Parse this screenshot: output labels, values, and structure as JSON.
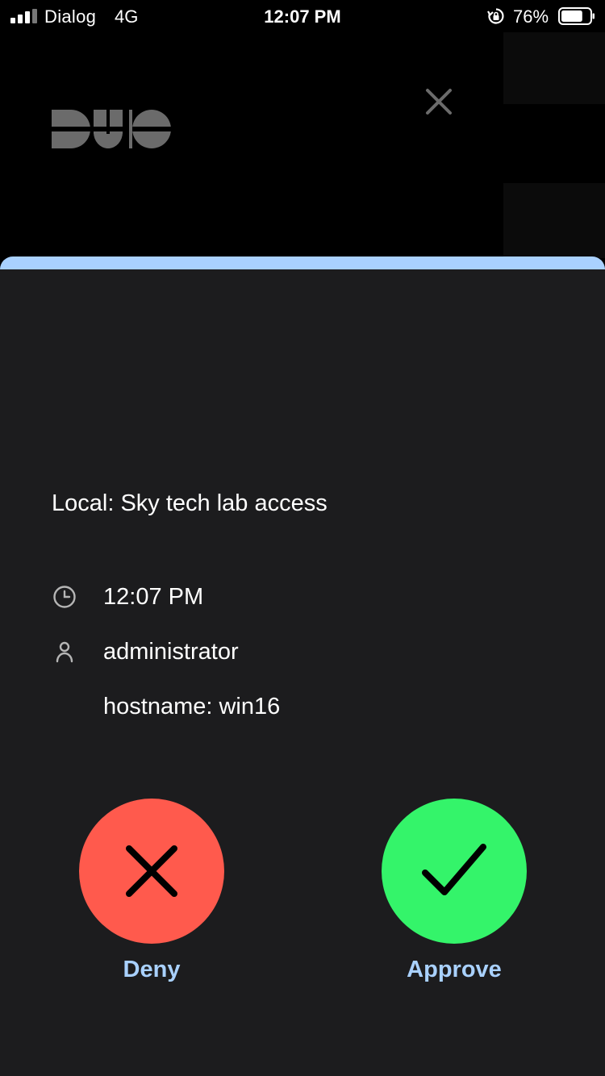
{
  "status_bar": {
    "carrier": "Dialog",
    "network": "4G",
    "time": "12:07 PM",
    "battery_percent": "76%",
    "battery_level": 0.76,
    "icons": [
      "signal-bars-icon",
      "rotation-lock-icon",
      "battery-icon"
    ]
  },
  "header": {
    "logo": "DUO",
    "close_icon": "close-icon"
  },
  "request": {
    "title": "Local: Sky tech lab access",
    "details": [
      {
        "icon": "clock-icon",
        "text": "12:07 PM"
      },
      {
        "icon": "user-icon",
        "text": "administrator"
      },
      {
        "icon": "",
        "text": "hostname: win16"
      }
    ]
  },
  "actions": {
    "deny_label": "Deny",
    "approve_label": "Approve",
    "deny_icon": "x-icon",
    "approve_icon": "checkmark-icon"
  },
  "colors": {
    "deny": "#ff5a4d",
    "approve": "#34f46a",
    "accent": "#a9d1ff",
    "sheet_background": "#1c1c1e"
  }
}
